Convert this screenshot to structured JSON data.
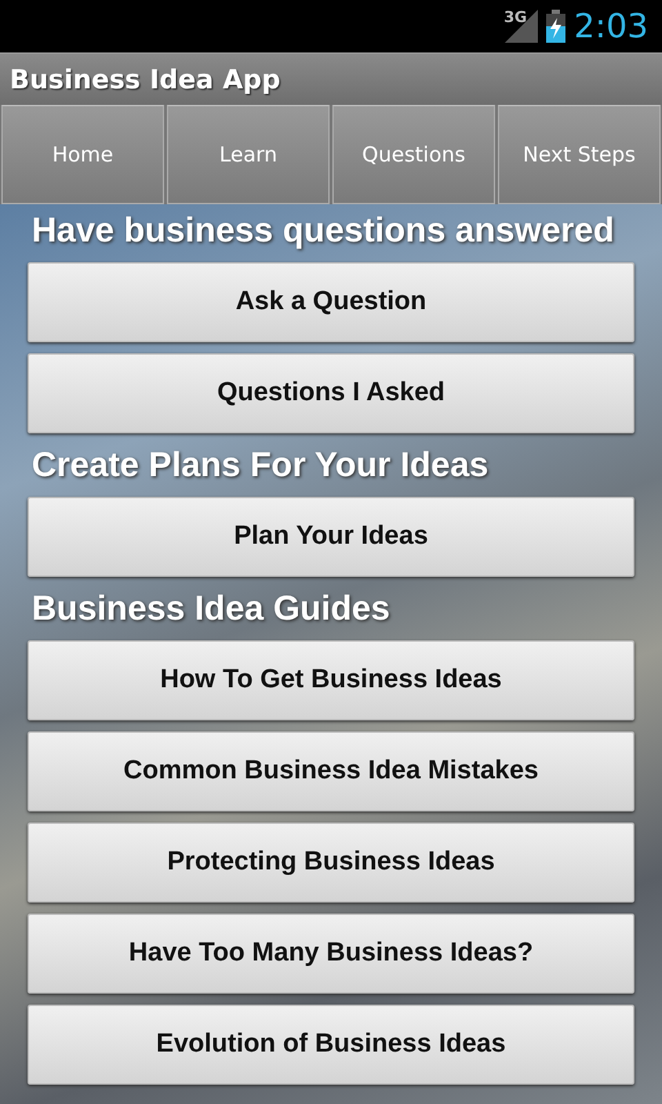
{
  "status_bar": {
    "network": "3G",
    "time": "2:03"
  },
  "app_bar": {
    "title": "Business Idea App"
  },
  "tabs": [
    {
      "label": "Home"
    },
    {
      "label": "Learn"
    },
    {
      "label": "Questions"
    },
    {
      "label": "Next Steps"
    }
  ],
  "sections": [
    {
      "heading": "Have business questions answered",
      "buttons": [
        "Ask a Question",
        "Questions I Asked"
      ]
    },
    {
      "heading": "Create Plans For Your Ideas",
      "buttons": [
        "Plan Your Ideas"
      ]
    },
    {
      "heading": "Business Idea Guides",
      "buttons": [
        "How To Get Business Ideas",
        "Common Business Idea Mistakes",
        "Protecting Business Ideas",
        "Have Too Many Business Ideas?",
        "Evolution of Business Ideas"
      ]
    }
  ]
}
